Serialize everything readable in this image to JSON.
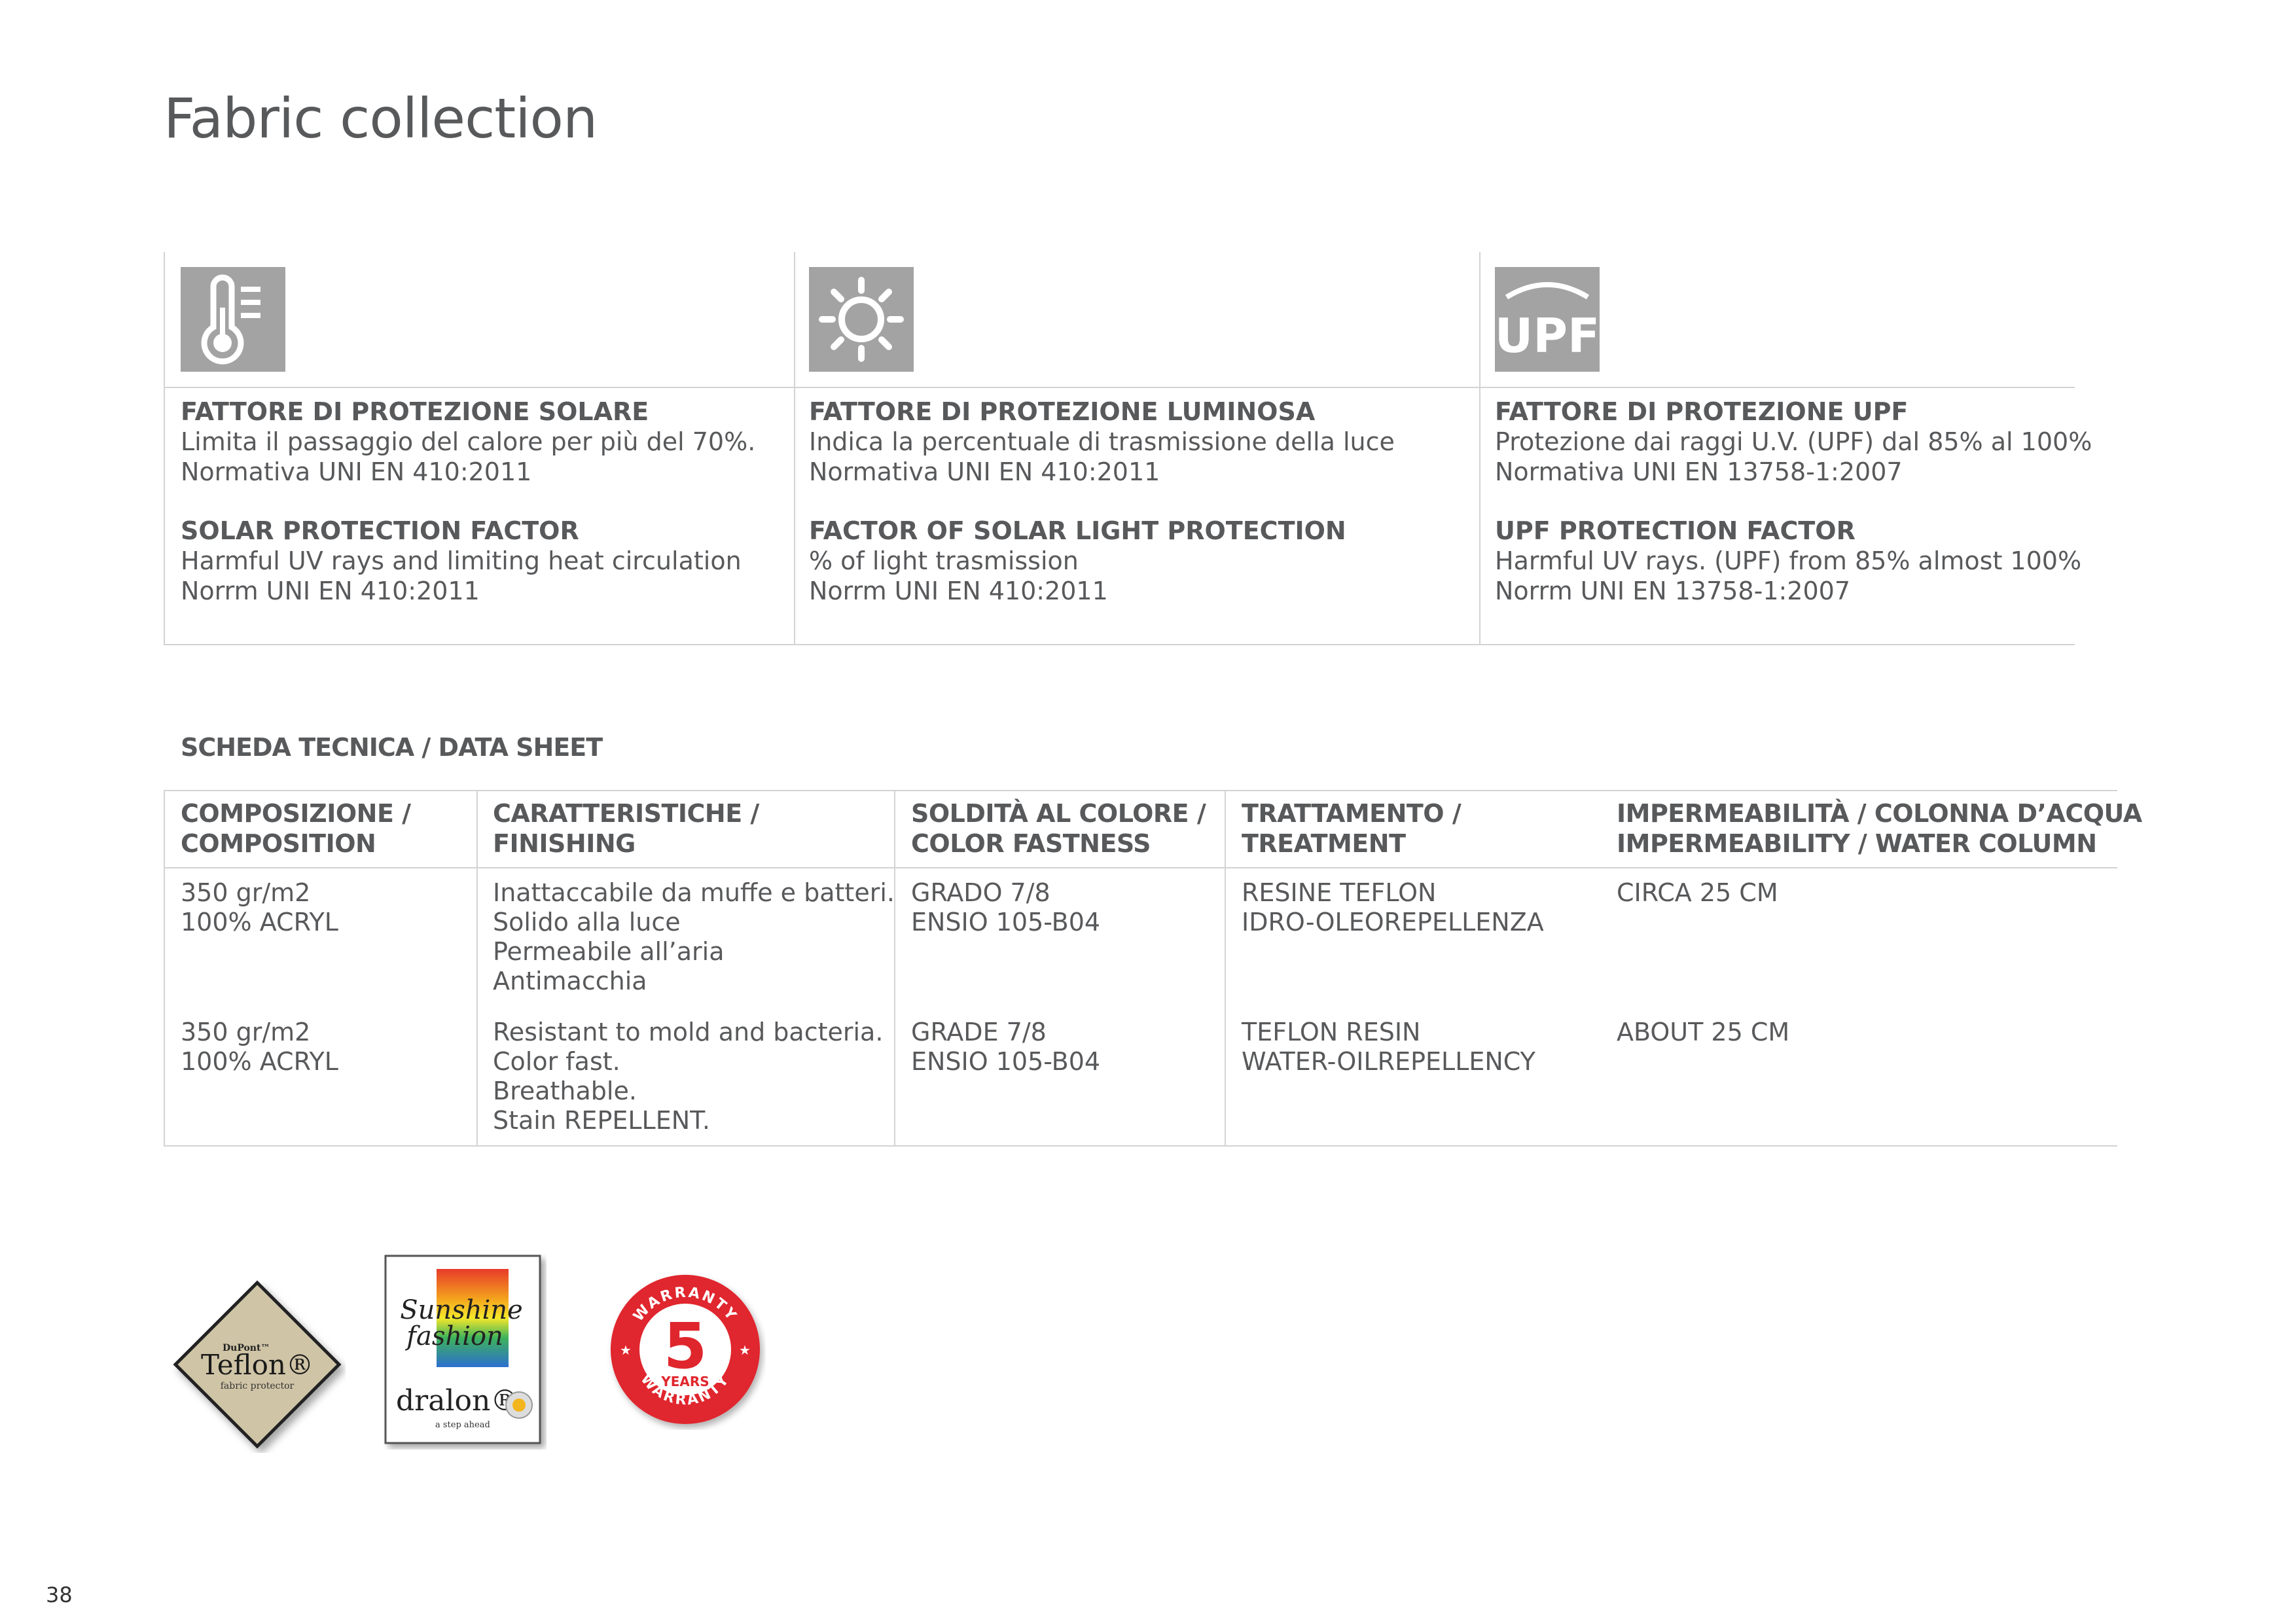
{
  "page": {
    "title": "Fabric collection",
    "page_number": "38"
  },
  "protection": [
    {
      "icon": "thermometer-icon",
      "it_title": "FATTORE DI PROTEZIONE SOLARE",
      "it_line1": "Limita il passaggio del calore per più del 70%.",
      "it_line2": "Normativa UNI EN 410:2011",
      "en_title": "SOLAR PROTECTION FACTOR",
      "en_line1": "Harmful UV rays and limiting heat circulation",
      "en_line2": "Norrm UNI EN 410:2011"
    },
    {
      "icon": "sun-icon",
      "it_title": "FATTORE DI PROTEZIONE LUMINOSA",
      "it_line1": "Indica la percentuale di trasmissione della luce",
      "it_line2": "Normativa UNI EN 410:2011",
      "en_title": "FACTOR OF SOLAR LIGHT PROTECTION",
      "en_line1": "% of light trasmission",
      "en_line2": "Norrm UNI EN 410:2011"
    },
    {
      "icon": "upf-icon",
      "icon_text": "UPF",
      "it_title": "FATTORE DI PROTEZIONE UPF",
      "it_line1": "Protezione dai raggi U.V. (UPF) dal 85% al 100%",
      "it_line2": "Normativa UNI EN 13758-1:2007",
      "en_title": "UPF PROTECTION FACTOR",
      "en_line1": "Harmful UV rays. (UPF) from 85% almost 100%",
      "en_line2": "Norrm UNI EN 13758-1:2007"
    }
  ],
  "datasheet": {
    "title": "SCHEDA TECNICA / DATA SHEET",
    "headers": [
      {
        "line1": "COMPOSIZIONE /",
        "line2": "COMPOSITION"
      },
      {
        "line1": "CARATTERISTICHE /",
        "line2": "FINISHING"
      },
      {
        "line1": "SOLDITÀ AL COLORE /",
        "line2": "COLOR FASTNESS"
      },
      {
        "line1": "TRATTAMENTO /",
        "line2": "TREATMENT"
      },
      {
        "line1": "IMPERMEABILITÀ / COLONNA D’ACQUA",
        "line2": "IMPERMEABILITY / WATER COLUMN"
      }
    ],
    "rows": [
      {
        "composition": [
          "350 gr/m2",
          "100% ACRYL"
        ],
        "finishing": [
          "Inattaccabile da muffe e batteri.",
          "Solido alla luce",
          "Permeabile all’aria",
          "Antimacchia"
        ],
        "fastness": [
          "GRADO 7/8",
          "ENSIO 105-B04"
        ],
        "treatment": [
          "RESINE TEFLON",
          "IDRO-OLEOREPELLENZA"
        ],
        "impermeability": [
          "CIRCA 25 CM"
        ]
      },
      {
        "composition": [
          "350 gr/m2",
          "100% ACRYL"
        ],
        "finishing": [
          "Resistant to mold and bacteria.",
          "Color fast.",
          "Breathable.",
          "Stain REPELLENT."
        ],
        "fastness": [
          "GRADE 7/8",
          "ENSIO 105-B04"
        ],
        "treatment": [
          "TEFLON RESIN",
          "WATER-OILREPELLENCY"
        ],
        "impermeability": [
          "ABOUT 25 CM"
        ]
      }
    ]
  },
  "logos": {
    "teflon": {
      "brand": "DuPont™",
      "name": "Teflon®",
      "tagline": "fabric protector"
    },
    "dralon": {
      "script1": "Sunshine",
      "script2": "fashion",
      "name": "dralon®",
      "tagline": "a step ahead"
    },
    "warranty": {
      "top": "WARRANTY",
      "number": "5",
      "years": "YEARS",
      "bottom": "WARRANTY",
      "color": "#e0262d"
    }
  }
}
